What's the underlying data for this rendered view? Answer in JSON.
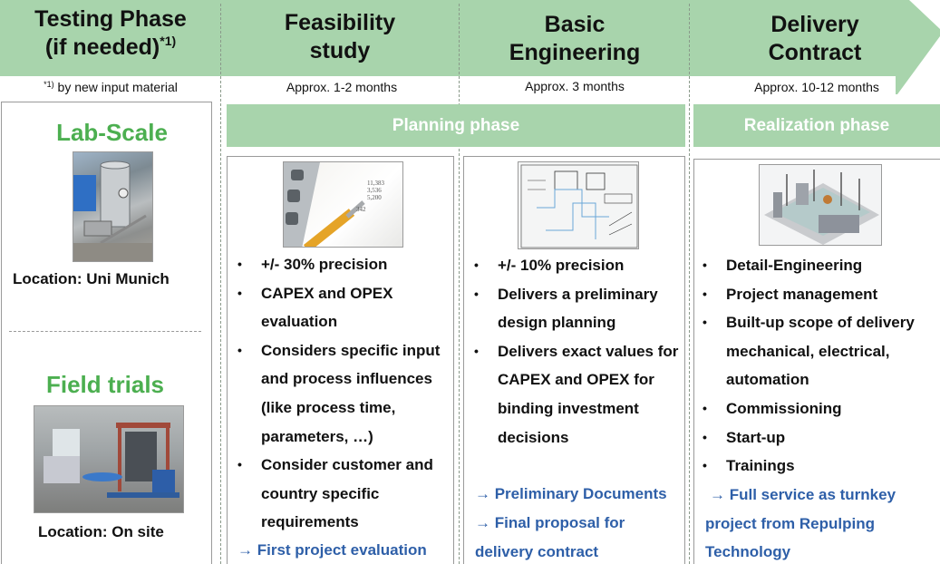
{
  "colors": {
    "banner_green": "#a8d4ac",
    "heading_green": "#4caf50",
    "result_blue": "#2e5fa8",
    "border_gray": "#9a9a9a"
  },
  "banner": {
    "phases": [
      {
        "title_line1": "Testing Phase",
        "title_line2": "(if needed)",
        "footnote_mark": "*1)",
        "duration_mark": "*1)",
        "duration": " by new input material"
      },
      {
        "title_line1": "Feasibility",
        "title_line2": "study",
        "duration": "Approx. 1-2 months"
      },
      {
        "title_line1": "Basic",
        "title_line2": "Engineering",
        "duration": "Approx. 3 months"
      },
      {
        "title_line1": "Delivery",
        "title_line2": "Contract",
        "duration": "Approx. 10-12 months"
      }
    ]
  },
  "phase_bars": {
    "planning": "Planning phase",
    "realization": "Realization phase"
  },
  "testing": {
    "lab": {
      "heading": "Lab-Scale",
      "image": "lab-scale-machine-photo",
      "location": "Location: Uni Munich"
    },
    "field": {
      "heading": "Field trials",
      "image": "field-trial-plant-photo",
      "location": "Location: On site"
    }
  },
  "feasibility": {
    "image": "calculator-and-pen-photo",
    "bullets": [
      "+/- 30% precision",
      "CAPEX and OPEX evaluation",
      "Considers specific input and process influences (like process time, parameters, …)",
      "Consider customer and country specific requirements"
    ],
    "results": [
      "→ First project evaluation"
    ]
  },
  "basic_engineering": {
    "image": "engineering-schematic-drawing",
    "bullets": [
      "+/- 10% precision",
      "Delivers a preliminary design planning",
      "Delivers exact values for CAPEX and OPEX for binding investment decisions"
    ],
    "results": [
      "→ Preliminary Documents",
      "→ Final proposal for delivery contract"
    ]
  },
  "delivery": {
    "image": "3d-plant-layout-render",
    "bullets": [
      "Detail-Engineering",
      "Project management",
      "Built-up scope of delivery mechanical, electrical, automation",
      "Commissioning",
      "Start-up",
      "Trainings"
    ],
    "results": [
      "→ Full service as turnkey project from Repulping Technology"
    ]
  }
}
